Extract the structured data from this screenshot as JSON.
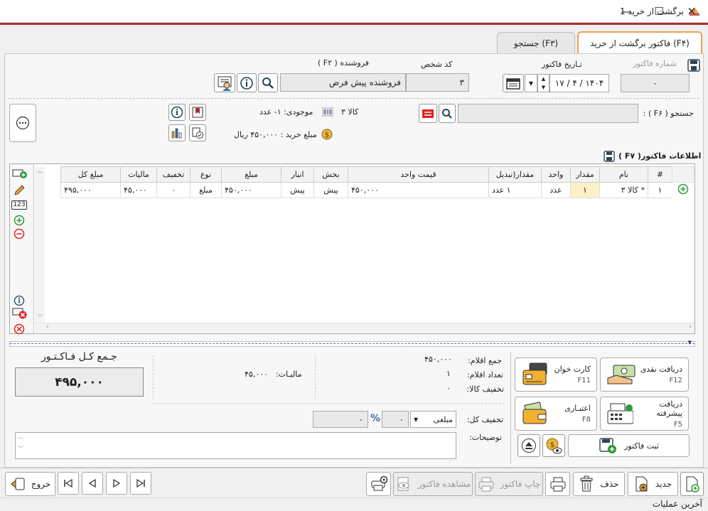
{
  "window": {
    "title": "برگشت از خرید 1",
    "minimize": "—",
    "maximize": "☐",
    "close": "✕"
  },
  "tabs": [
    {
      "label": "فاکتور برگشت از خرید (F۴)"
    },
    {
      "label": "جستجو (F۳)"
    }
  ],
  "header": {
    "invoice_number_label": "شماره فاکتور",
    "invoice_number_value": "۰",
    "invoice_date_label": "تـاریخ فاکتور",
    "invoice_date_value": "۱۴۰۴ / ۴ / ۱۷",
    "person_code_label": "کد شخص",
    "person_code_value": "۳",
    "seller_label": "فروشنده ( F۲ )",
    "seller_value": "فروشنده پیش فرض"
  },
  "item_search": {
    "label": "جستجو ( F۶ ) :",
    "value": "",
    "product_name": "کالا ۳",
    "stock_text": "موجودی: ۱- عدد",
    "purchase_amount_text": "مبلغ خرید : ۴۵۰,۰۰۰ ریال"
  },
  "invoice_info_title": "اطلاعات فاکتور( F۷ )",
  "grid": {
    "columns": [
      "#",
      "نام",
      "مقدار",
      "واحد",
      "مقدار(تبدیل",
      "قیمت واحد",
      "بخش",
      "انبار",
      "مبلغ",
      "نوع",
      "تخفیف",
      "مالیات",
      "مبلغ کل"
    ],
    "rows": [
      [
        "۱",
        "* کالا ۳",
        "۱",
        "عدد",
        "۱ عدد",
        "۴۵۰,۰۰۰",
        "پیش",
        "پیش",
        "۴۵۰,۰۰۰",
        "مبلغ",
        "۰",
        "۴۵,۰۰۰",
        "۴۹۵,۰۰۰"
      ]
    ]
  },
  "summary": {
    "items_total_label": "جمع اقلام:",
    "items_total_value": "۴۵۰,۰۰۰",
    "items_count_label": "تعداد اقلام:",
    "items_count_value": "۱",
    "item_discount_label": "تخفیف کالا:",
    "item_discount_value": "۰",
    "tax_label": "مالیـات:",
    "tax_value": "۴۵,۰۰۰",
    "grand_total_label": "جـمع کـل فـاکـتـور",
    "grand_total_value": "۴۹۵,۰۰۰",
    "overall_discount_label": "تخفیف کل:",
    "discount_type": "مبلغی",
    "discount_value": "۰",
    "discount_amount": "۰",
    "percent_sign": "%",
    "notes_label": "توضیحات:",
    "notes_value": ""
  },
  "payment": {
    "cash_label": "دریافت نقدی",
    "cash_key": "F12",
    "card_label": "کارت خوان",
    "card_key": "F11",
    "advanced_label": "دریافت پیشرفته",
    "advanced_key": "F5",
    "credit_label": "اعتبـاری",
    "credit_key": "F8",
    "register_label": "ثبت فاکتور"
  },
  "bottom": {
    "new_label": "جدید",
    "delete_label": "حذف",
    "print_label": "چاپ فاکتور",
    "view_label": "مشاهده فاکتور",
    "exit_label": "خروج"
  },
  "status": {
    "text": "آخرین عملیات"
  },
  "colors": {
    "accent": "#a8323a",
    "tab_active_border": "#f0a050",
    "highlight_cell": "#fdf0c8",
    "green": "#2f9a3a",
    "red": "#d22"
  }
}
